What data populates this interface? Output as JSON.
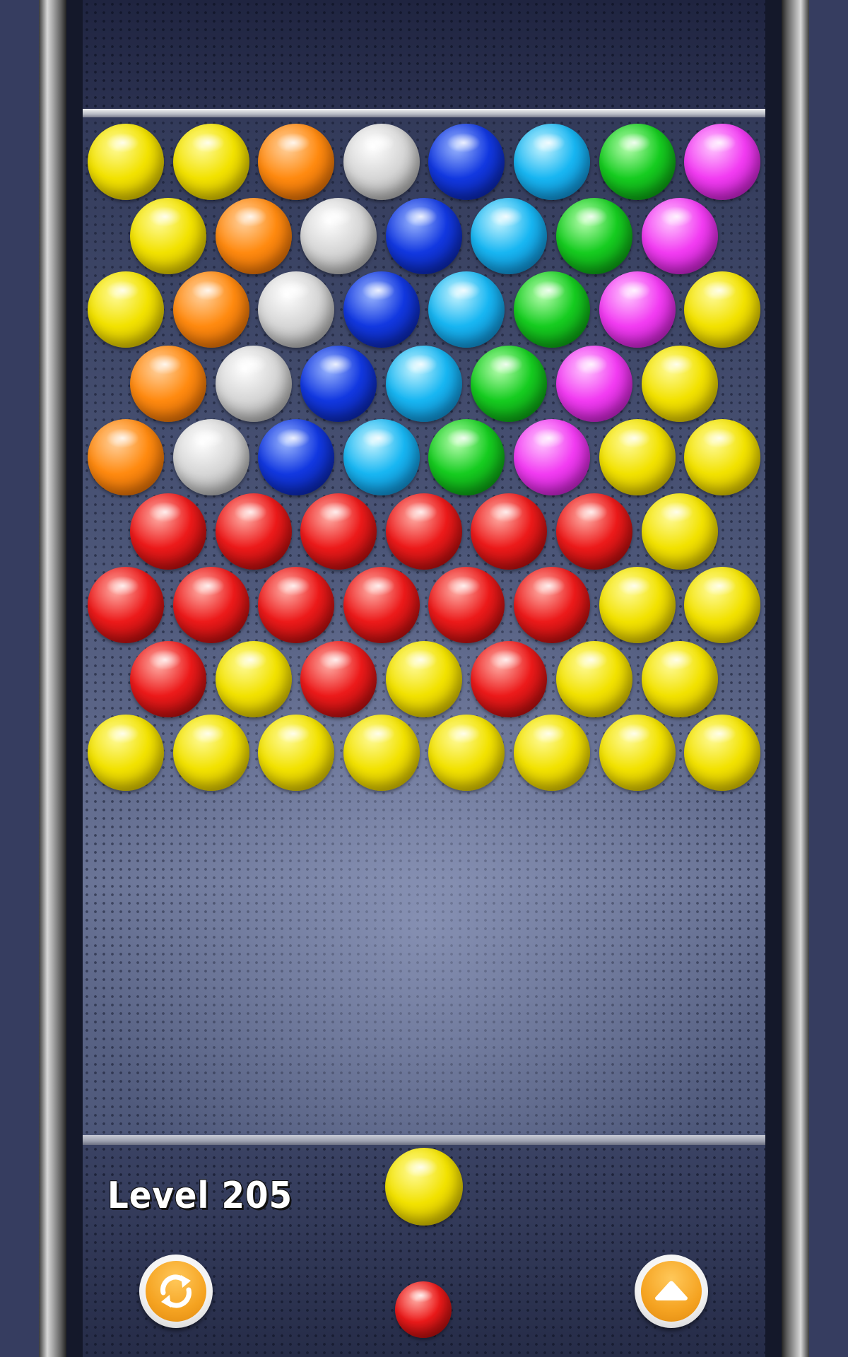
{
  "level": {
    "label": "Level 205"
  },
  "palette": {
    "yellow": [
      "#fffb9a",
      "#f2e200",
      "#b8a000"
    ],
    "orange": [
      "#ffd2a0",
      "#ff8a10",
      "#c45a00"
    ],
    "white": [
      "#ffffff",
      "#d6d6d6",
      "#8c8c8c"
    ],
    "blue": [
      "#9db8ff",
      "#1238e0",
      "#061a8a"
    ],
    "cyan": [
      "#c6f4ff",
      "#18b6f2",
      "#0a6fb0"
    ],
    "green": [
      "#b8ffb0",
      "#16cc20",
      "#057a0c"
    ],
    "magenta": [
      "#ffc8ff",
      "#f23cf2",
      "#a010a8"
    ],
    "red": [
      "#ffb0a8",
      "#ec1a1a",
      "#8e0606"
    ]
  },
  "grid": {
    "rows": [
      [
        "yellow",
        "yellow",
        "orange",
        "white",
        "blue",
        "cyan",
        "green",
        "magenta"
      ],
      [
        "yellow",
        "orange",
        "white",
        "blue",
        "cyan",
        "green",
        "magenta"
      ],
      [
        "yellow",
        "orange",
        "white",
        "blue",
        "cyan",
        "green",
        "magenta",
        "yellow"
      ],
      [
        "orange",
        "white",
        "blue",
        "cyan",
        "green",
        "magenta",
        "yellow"
      ],
      [
        "orange",
        "white",
        "blue",
        "cyan",
        "green",
        "magenta",
        "yellow",
        "yellow"
      ],
      [
        "red",
        "red",
        "red",
        "red",
        "red",
        "red",
        "yellow"
      ],
      [
        "red",
        "red",
        "red",
        "red",
        "red",
        "red",
        "yellow",
        "yellow"
      ],
      [
        "red",
        "yellow",
        "red",
        "yellow",
        "red",
        "yellow",
        "yellow"
      ],
      [
        "yellow",
        "yellow",
        "yellow",
        "yellow",
        "yellow",
        "yellow",
        "yellow",
        "yellow"
      ]
    ]
  },
  "shooter": {
    "current": "yellow",
    "next": "red"
  },
  "buttons": {
    "swap": {
      "icon": "swap-arrows-icon"
    },
    "up": {
      "icon": "arrow-up-icon"
    }
  }
}
